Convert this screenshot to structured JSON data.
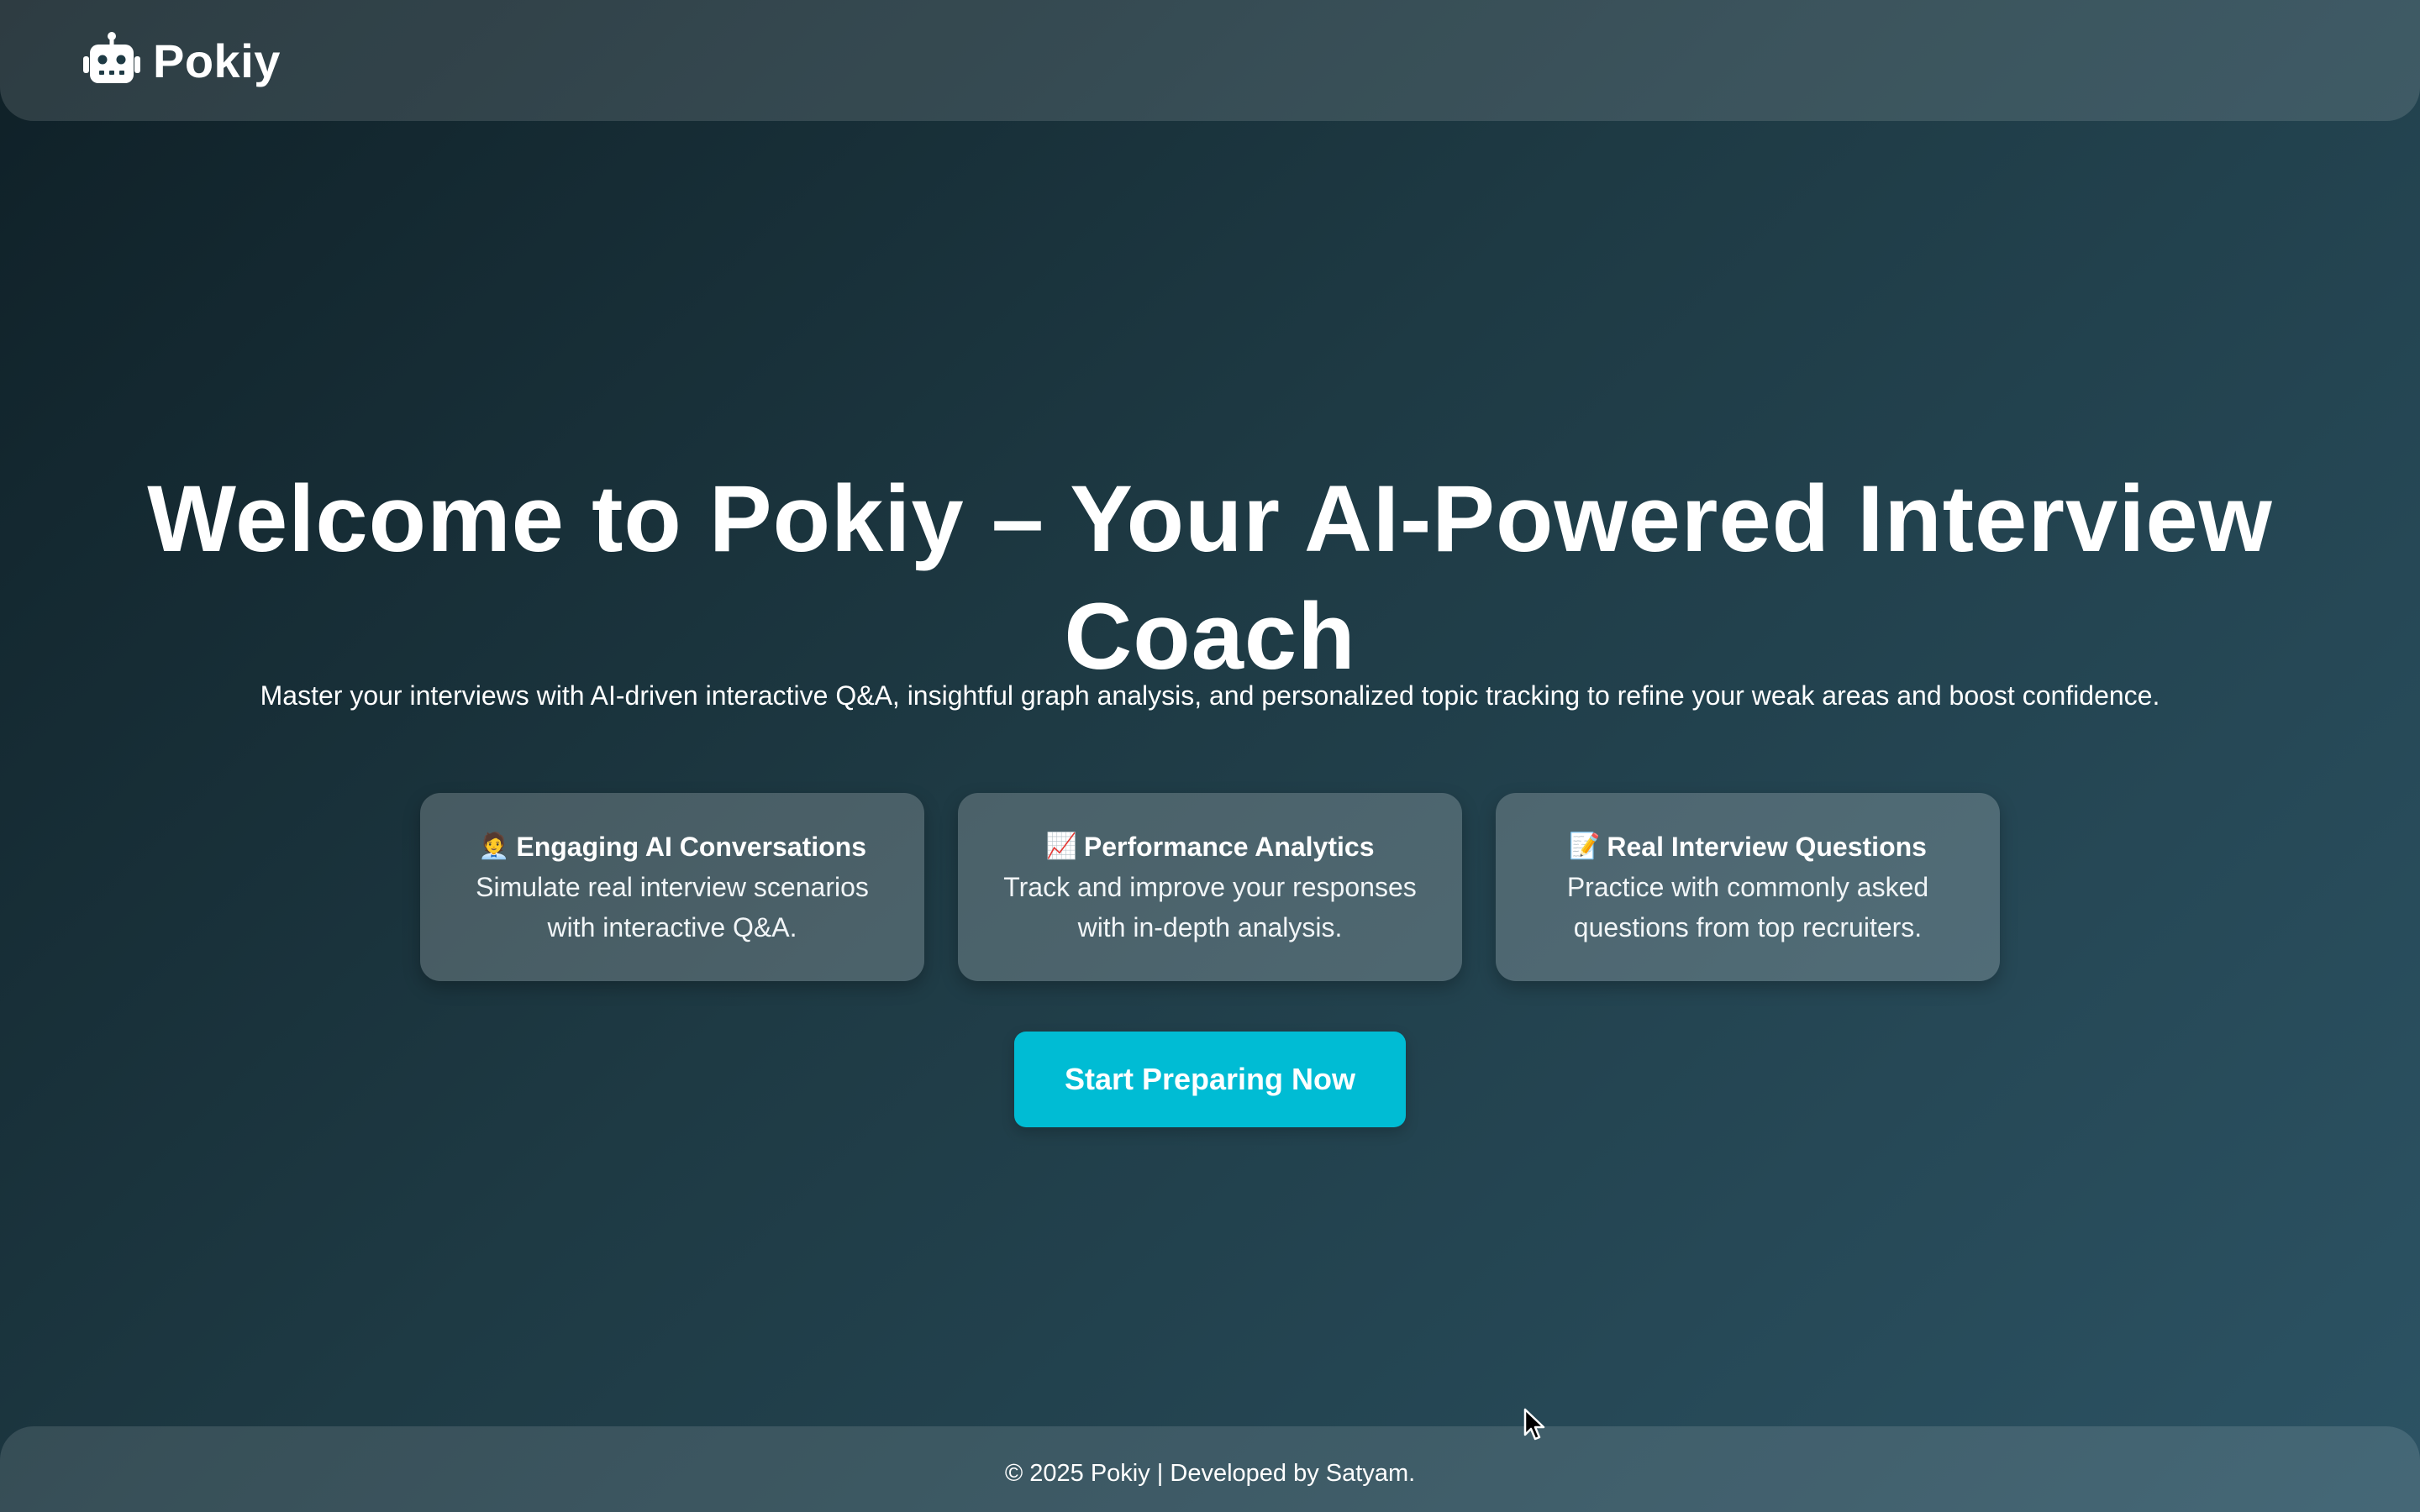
{
  "header": {
    "brand_name": "Pokiy",
    "logo_icon": "robot-icon"
  },
  "hero": {
    "title": "Welcome to Pokiy – Your AI-Powered Interview Coach",
    "subtitle": "Master your interviews with AI-driven interactive Q&A, insightful graph analysis, and personalized topic tracking to refine your weak areas and boost confidence."
  },
  "features": [
    {
      "emoji": "🧑‍💼",
      "icon": "office-worker-icon",
      "title": "Engaging AI Conversations",
      "line1": "Simulate real interview scenarios",
      "line2": "with interactive Q&A."
    },
    {
      "emoji": "📈",
      "icon": "chart-increasing-icon",
      "title": "Performance Analytics",
      "line1": "Track and improve your responses",
      "line2": "with in-depth analysis."
    },
    {
      "emoji": "📝",
      "icon": "memo-icon",
      "title": "Real Interview Questions",
      "line1": "Practice with commonly asked",
      "line2": "questions from top recruiters."
    }
  ],
  "cta": {
    "label": "Start Preparing Now"
  },
  "footer": {
    "text": "© 2025 Pokiy | Developed by Satyam."
  },
  "colors": {
    "background_start": "#0f2027",
    "background_end": "#2c5364",
    "accent": "#00bcd4",
    "text": "#ffffff"
  }
}
